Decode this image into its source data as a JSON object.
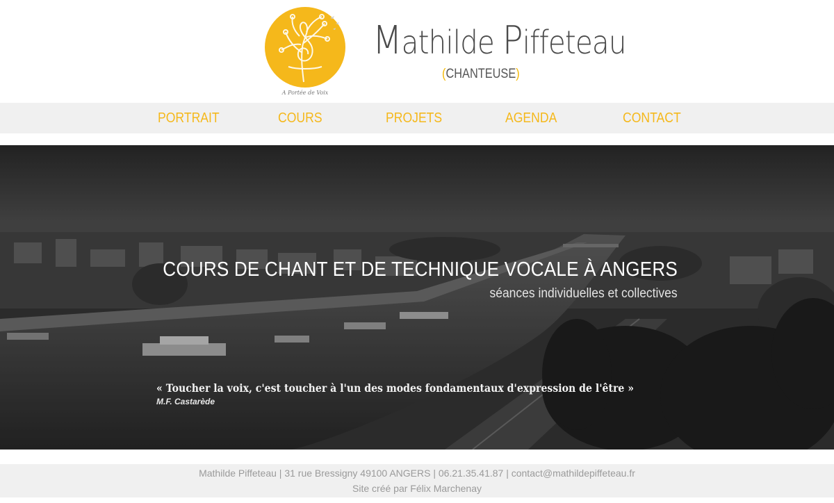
{
  "header": {
    "name_initial_1": "M",
    "name_rest_1": "athilde ",
    "name_initial_2": "P",
    "name_rest_2": "iffeteau",
    "subtitle_open": "(",
    "subtitle": "CHANTEUSE",
    "subtitle_close": ")",
    "logo_caption": "A Portée de Voix",
    "logo_color": "#f5b81b"
  },
  "nav": {
    "items": [
      {
        "label": "PORTRAIT"
      },
      {
        "label": "COURS"
      },
      {
        "label": "PROJETS"
      },
      {
        "label": "AGENDA"
      },
      {
        "label": "CONTACT"
      }
    ],
    "color": "#f5b81b"
  },
  "hero": {
    "title": "COURS DE CHANT ET DE TECHNIQUE VOCALE À ANGERS",
    "subtitle": "séances individuelles et collectives",
    "quote": "« Toucher la voix, c'est toucher à l'un des modes fondamentaux d'expression de l'être »",
    "quote_author": "M.F. Castarède"
  },
  "footer": {
    "name": "Mathilde Piffeteau",
    "address": "31 rue Bressigny 49100 ANGERS",
    "phone": "06.21.35.41.87",
    "email": "contact@mathildepiffeteau.fr",
    "credit_prefix": "Site créé par",
    "credit_name": "Félix Marchenay",
    "separator": " | "
  }
}
